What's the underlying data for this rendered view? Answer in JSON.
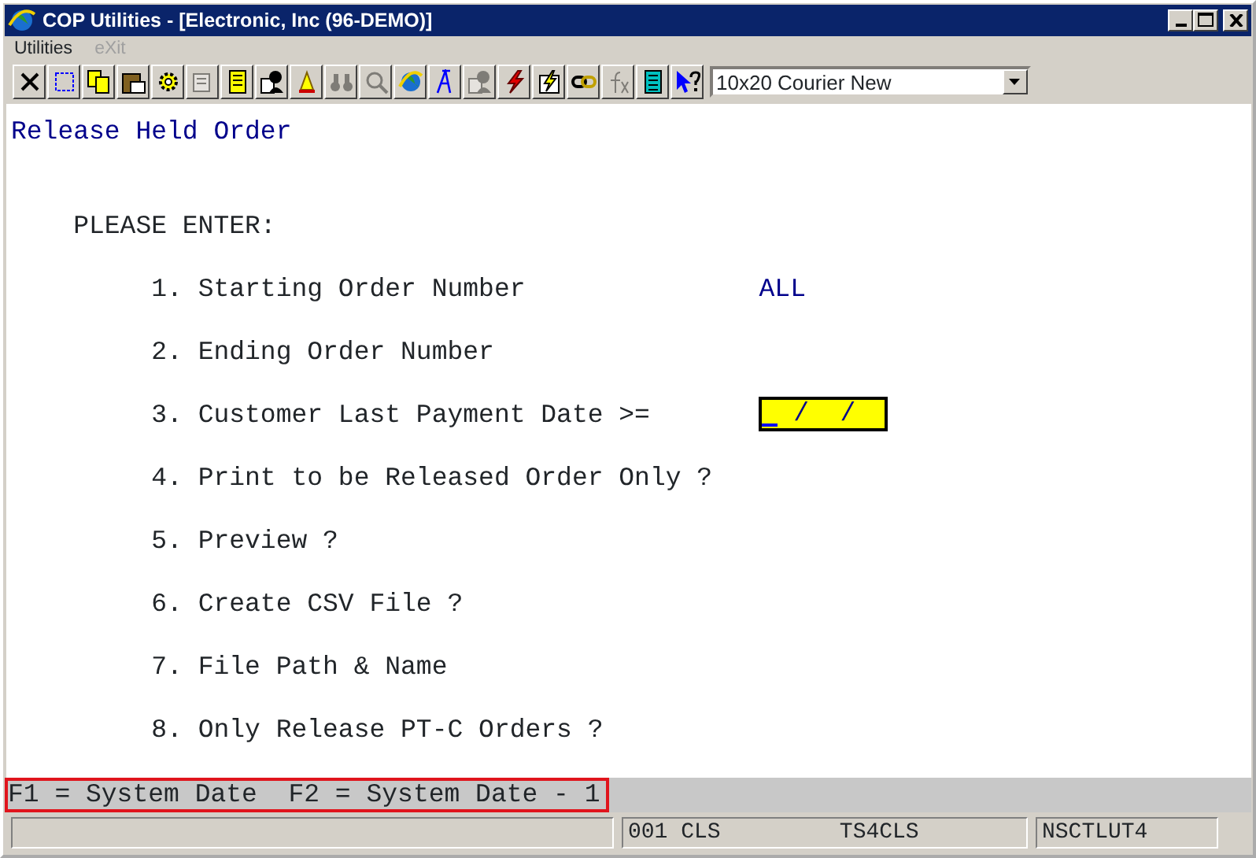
{
  "window": {
    "title": "COP Utilities - [Electronic, Inc (96-DEMO)]"
  },
  "menu": [
    {
      "label": "Utilities",
      "disabled": false
    },
    {
      "label": "eXit",
      "disabled": true
    }
  ],
  "toolbar": [
    {
      "kind": "close",
      "disabled": false
    },
    {
      "kind": "select",
      "disabled": false
    },
    {
      "kind": "copy",
      "disabled": false
    },
    {
      "kind": "paste",
      "disabled": false
    },
    {
      "kind": "gear",
      "disabled": false
    },
    {
      "kind": "properties",
      "disabled": true
    },
    {
      "kind": "notes",
      "disabled": false
    },
    {
      "kind": "person",
      "disabled": false
    },
    {
      "kind": "bell",
      "disabled": false
    },
    {
      "kind": "binoculars",
      "disabled": true
    },
    {
      "kind": "search",
      "disabled": true
    },
    {
      "kind": "globe",
      "disabled": false
    },
    {
      "kind": "font",
      "disabled": false
    },
    {
      "kind": "person",
      "disabled": true
    },
    {
      "kind": "lightning",
      "disabled": false
    },
    {
      "kind": "lightning-doc",
      "disabled": false
    },
    {
      "kind": "link",
      "disabled": false
    },
    {
      "kind": "function",
      "disabled": true
    },
    {
      "kind": "list",
      "disabled": false
    },
    {
      "kind": "help",
      "disabled": false
    }
  ],
  "font_select": {
    "value": "10x20 Courier New"
  },
  "screen": {
    "title": "Release Held Order",
    "prompt": "PLEASE ENTER:",
    "fields": [
      {
        "label": "1. Starting Order Number",
        "value": "ALL",
        "kind": "text"
      },
      {
        "label": "2. Ending Order Number",
        "kind": "text"
      },
      {
        "label": "3. Customer Last Payment Date >=",
        "value": "  /  /",
        "kind": "input",
        "focused": true
      },
      {
        "label": "4. Print to be Released Order Only ?",
        "kind": "text"
      },
      {
        "label": "5. Preview ?",
        "kind": "text"
      },
      {
        "label": "6. Create CSV File ?",
        "kind": "text"
      },
      {
        "label": "7. File Path & Name",
        "kind": "text"
      },
      {
        "label": "8. Only Release PT-C Orders ?",
        "kind": "text"
      }
    ]
  },
  "hint": "F1 = System Date  F2 = System Date - 1",
  "status_bar": {
    "panel_2": [
      "001 CLS",
      "TS4CLS"
    ],
    "panel_3": "NSCTLUT4"
  }
}
